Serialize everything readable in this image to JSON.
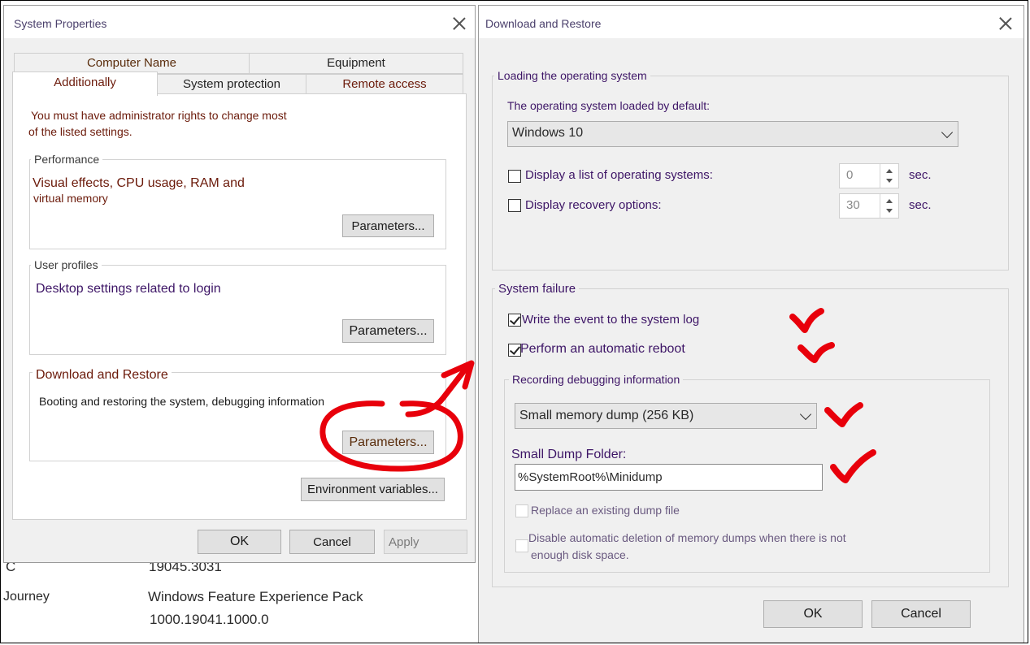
{
  "background": {
    "row1_label": "C",
    "row1_value": "19045.3031",
    "row2_label": "Journey",
    "row2_value_line1": "Windows Feature Experience Pack",
    "row2_value_line2": "1000.19041.1000.0"
  },
  "system_properties": {
    "title": "System Properties",
    "tabs_top": [
      "Computer Name",
      "Equipment"
    ],
    "tabs_bottom": [
      "Additionally",
      "System protection",
      "Remote access"
    ],
    "active_tab": "Additionally",
    "admin_note_line1": "You must have administrator rights to change most",
    "admin_note_line2": "of the listed settings.",
    "performance": {
      "legend": "Performance",
      "desc_line1": "Visual effects, CPU usage, RAM and",
      "desc_line2": "virtual memory",
      "button": "Parameters..."
    },
    "user_profiles": {
      "legend": "User profiles",
      "desc": "Desktop settings related to login",
      "button": "Parameters..."
    },
    "download_restore": {
      "legend": "Download and Restore",
      "desc": "Booting and restoring the system, debugging information",
      "button": "Parameters..."
    },
    "env_button": "Environment variables...",
    "ok": "OK",
    "cancel": "Cancel",
    "apply": "Apply"
  },
  "download_restore_dialog": {
    "title": "Download and Restore",
    "loading": {
      "legend": "Loading the operating system",
      "default_os_label": "The operating system loaded by default:",
      "default_os_value": "Windows 10",
      "display_list_label": "Display a list of operating systems:",
      "display_list_checked": false,
      "display_list_seconds": "0",
      "display_recovery_label": "Display recovery options:",
      "display_recovery_checked": false,
      "display_recovery_seconds": "30",
      "sec_unit": "sec."
    },
    "failure": {
      "legend": "System failure",
      "write_event_label": "Write the event to the system log",
      "write_event_checked": true,
      "auto_reboot_label": "Perform an automatic reboot",
      "auto_reboot_checked": true,
      "debug": {
        "legend": "Recording debugging information",
        "dump_type": "Small memory dump (256 KB)",
        "folder_label": "Small Dump Folder:",
        "folder_value": "%SystemRoot%\\Minidump",
        "replace_label": "Replace an existing dump file",
        "disable_delete_line1": "Disable automatic deletion of memory dumps when there is not",
        "disable_delete_line2": "enough disk space."
      }
    },
    "ok": "OK",
    "cancel": "Cancel"
  },
  "annotation_color": "#e8000b"
}
